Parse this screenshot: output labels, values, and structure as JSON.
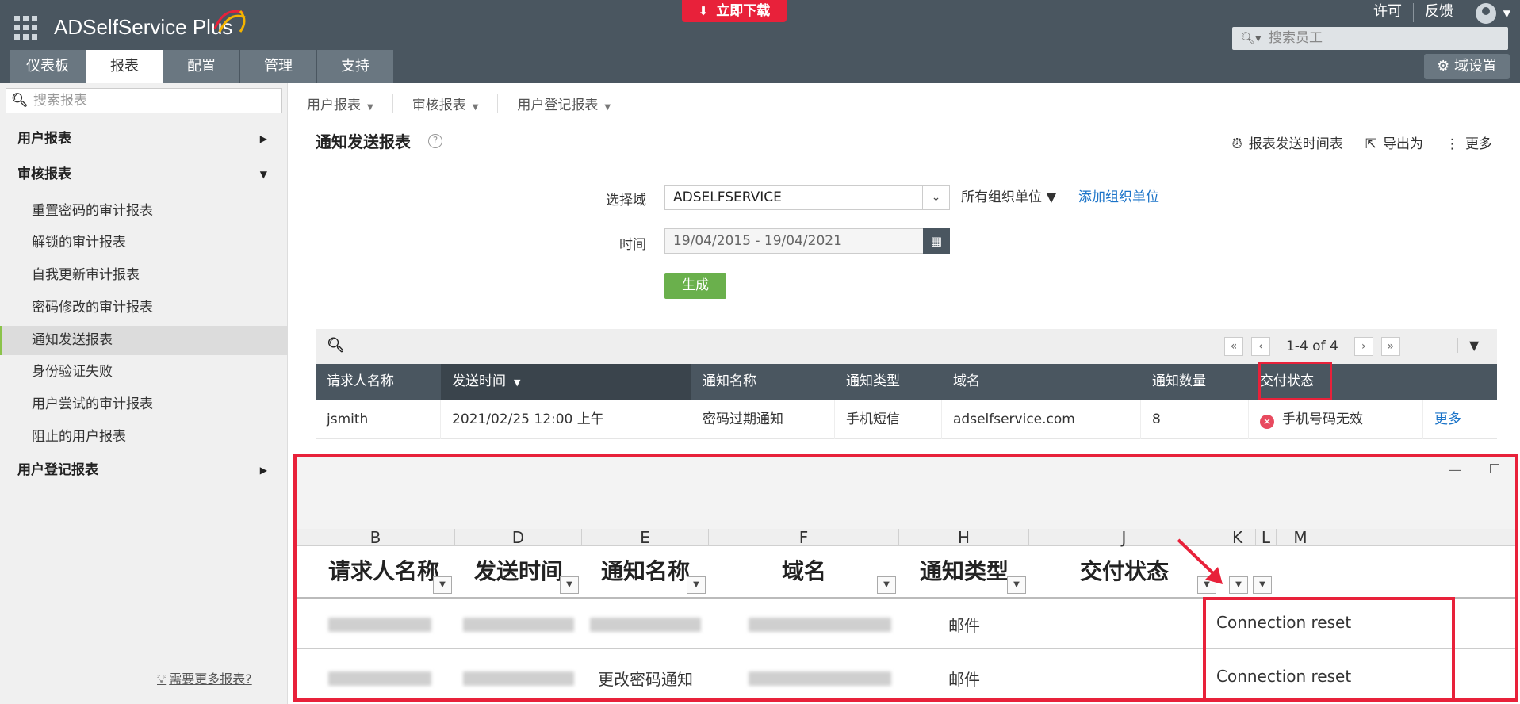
{
  "app": {
    "title": "ADSelfService Plus"
  },
  "header": {
    "download_label": "立即下载",
    "license_link": "许可",
    "feedback_link": "反馈",
    "employee_search_placeholder": "搜索员工",
    "domain_settings_label": "域设置"
  },
  "tabs": [
    "仪表板",
    "报表",
    "配置",
    "管理",
    "支持"
  ],
  "active_tab": "报表",
  "sidebar": {
    "search_placeholder": "搜索报表",
    "sections": [
      {
        "label": "用户报表",
        "expanded": false
      },
      {
        "label": "审核报表",
        "expanded": true
      },
      {
        "label": "用户登记报表",
        "expanded": false
      }
    ],
    "audit_items": [
      "重置密码的审计报表",
      "解锁的审计报表",
      "自我更新审计报表",
      "密码修改的审计报表",
      "通知发送报表",
      "身份验证失败",
      "用户尝试的审计报表",
      "阻止的用户报表"
    ],
    "active_item": "通知发送报表",
    "need_more": "需要更多报表?"
  },
  "subnav": [
    "用户报表",
    "审核报表",
    "用户登记报表"
  ],
  "page": {
    "title": "通知发送报表",
    "actions": [
      "报表发送时间表",
      "导出为",
      "更多"
    ],
    "form": {
      "domain_label": "选择域",
      "domain_value": "ADSELFSERVICE",
      "all_ou": "所有组织单位",
      "add_ou": "添加组织单位",
      "time_label": "时间",
      "date_range": "19/04/2015 - 19/04/2021",
      "generate": "生成"
    },
    "pager": "1-4 of 4",
    "columns": [
      "请求人名称",
      "发送时间",
      "通知名称",
      "通知类型",
      "域名",
      "通知数量",
      "交付状态"
    ],
    "rows": [
      {
        "requester": "jsmith",
        "sent_time": "2021/02/25 12:00 上午",
        "notification": "密码过期通知",
        "type": "手机短信",
        "domain": "adselfservice.com",
        "count": "8",
        "status": "手机号码无效",
        "more": "更多"
      }
    ]
  },
  "excel": {
    "column_letters": [
      "B",
      "D",
      "E",
      "F",
      "H",
      "J",
      "K",
      "L",
      "M"
    ],
    "headers": [
      "请求人名称",
      "发送时间",
      "通知名称",
      "域名",
      "通知类型",
      "交付状态"
    ],
    "rows": [
      {
        "notification": "",
        "type": "邮件",
        "status": "Connection reset"
      },
      {
        "notification": "更改密码通知",
        "type": "邮件",
        "status": "Connection reset"
      }
    ]
  },
  "colors": {
    "header_bg": "#4a5660",
    "accent_red": "#e8213a",
    "generate_green": "#6ab04c",
    "link_blue": "#1a73c8"
  }
}
